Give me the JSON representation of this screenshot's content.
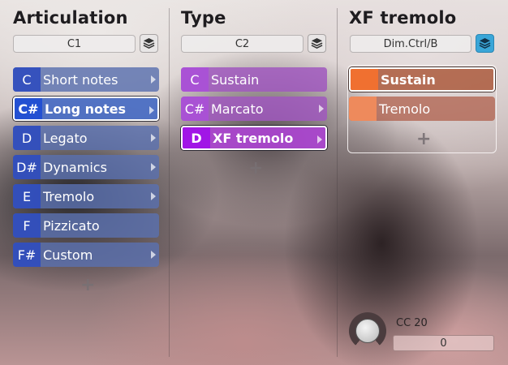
{
  "columns": [
    {
      "title": "Articulation",
      "selector_value": "C1",
      "items": [
        {
          "note": "C",
          "label": "Short notes"
        },
        {
          "note": "C#",
          "label": "Long notes"
        },
        {
          "note": "D",
          "label": "Legato"
        },
        {
          "note": "D#",
          "label": "Dynamics"
        },
        {
          "note": "E",
          "label": "Tremolo"
        },
        {
          "note": "F",
          "label": "Pizzicato"
        },
        {
          "note": "F#",
          "label": "Custom"
        }
      ],
      "add_label": "+"
    },
    {
      "title": "Type",
      "selector_value": "C2",
      "items": [
        {
          "note": "C",
          "label": "Sustain"
        },
        {
          "note": "C#",
          "label": "Marcato"
        },
        {
          "note": "D",
          "label": "XF tremolo"
        }
      ],
      "add_label": "+"
    },
    {
      "title": "XF tremolo",
      "selector_value": "Dim.Ctrl/B",
      "items": [
        {
          "note": "",
          "label": "Sustain"
        },
        {
          "note": "",
          "label": "Tremolo"
        }
      ],
      "add_label": "+"
    }
  ],
  "cc": {
    "label": "CC 20",
    "value": "0"
  },
  "colors": {
    "articulation": "#2d4bbe",
    "type": "#a116e6",
    "xf": "#f07030",
    "active_stack": "#3aa6d8"
  },
  "icons": {
    "stack": "layers-icon",
    "arrow": "chevron-right-icon",
    "knob": "knob-icon"
  }
}
